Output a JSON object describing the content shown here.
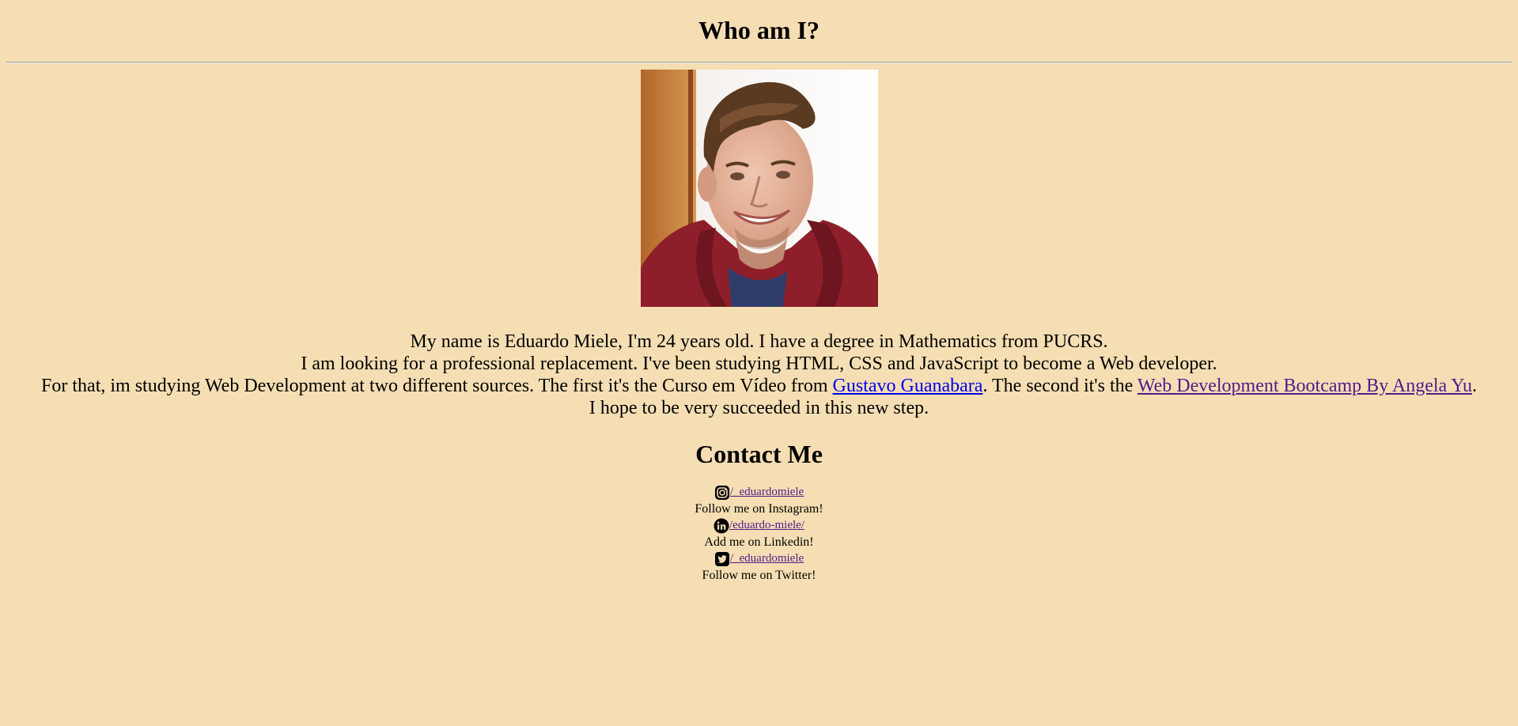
{
  "header": {
    "title": "Who am I?"
  },
  "bio": {
    "line1": "My name is Eduardo Miele, I'm 24 years old. I have a degree in Mathematics from PUCRS.",
    "line2": "I am looking for a professional replacement. I've been studying HTML, CSS and JavaScript to become a Web developer.",
    "line3_pre": "For that, im studying Web Development at two different sources. The first it's the Curso em Vídeo from ",
    "link1": "Gustavo Guanabara",
    "line3_mid": ". The second it's the ",
    "link2": "Web Development Bootcamp By Angela Yu",
    "line3_post": ".",
    "line4": "I hope to be very succeeded in this new step."
  },
  "contact": {
    "title": "Contact Me",
    "items": [
      {
        "icon": "instagram-icon",
        "handle": "/_eduardomiele",
        "caption": "Follow me on Instagram!"
      },
      {
        "icon": "linkedin-icon",
        "handle": "/eduardo-miele/",
        "caption": "Add me on Linkedin!"
      },
      {
        "icon": "twitter-icon",
        "handle": "/_eduardomiele",
        "caption": "Follow me on Twitter!"
      }
    ]
  },
  "colors": {
    "background": "#f5deb3",
    "link": "#0000ee",
    "visited_link": "#551a8b"
  }
}
